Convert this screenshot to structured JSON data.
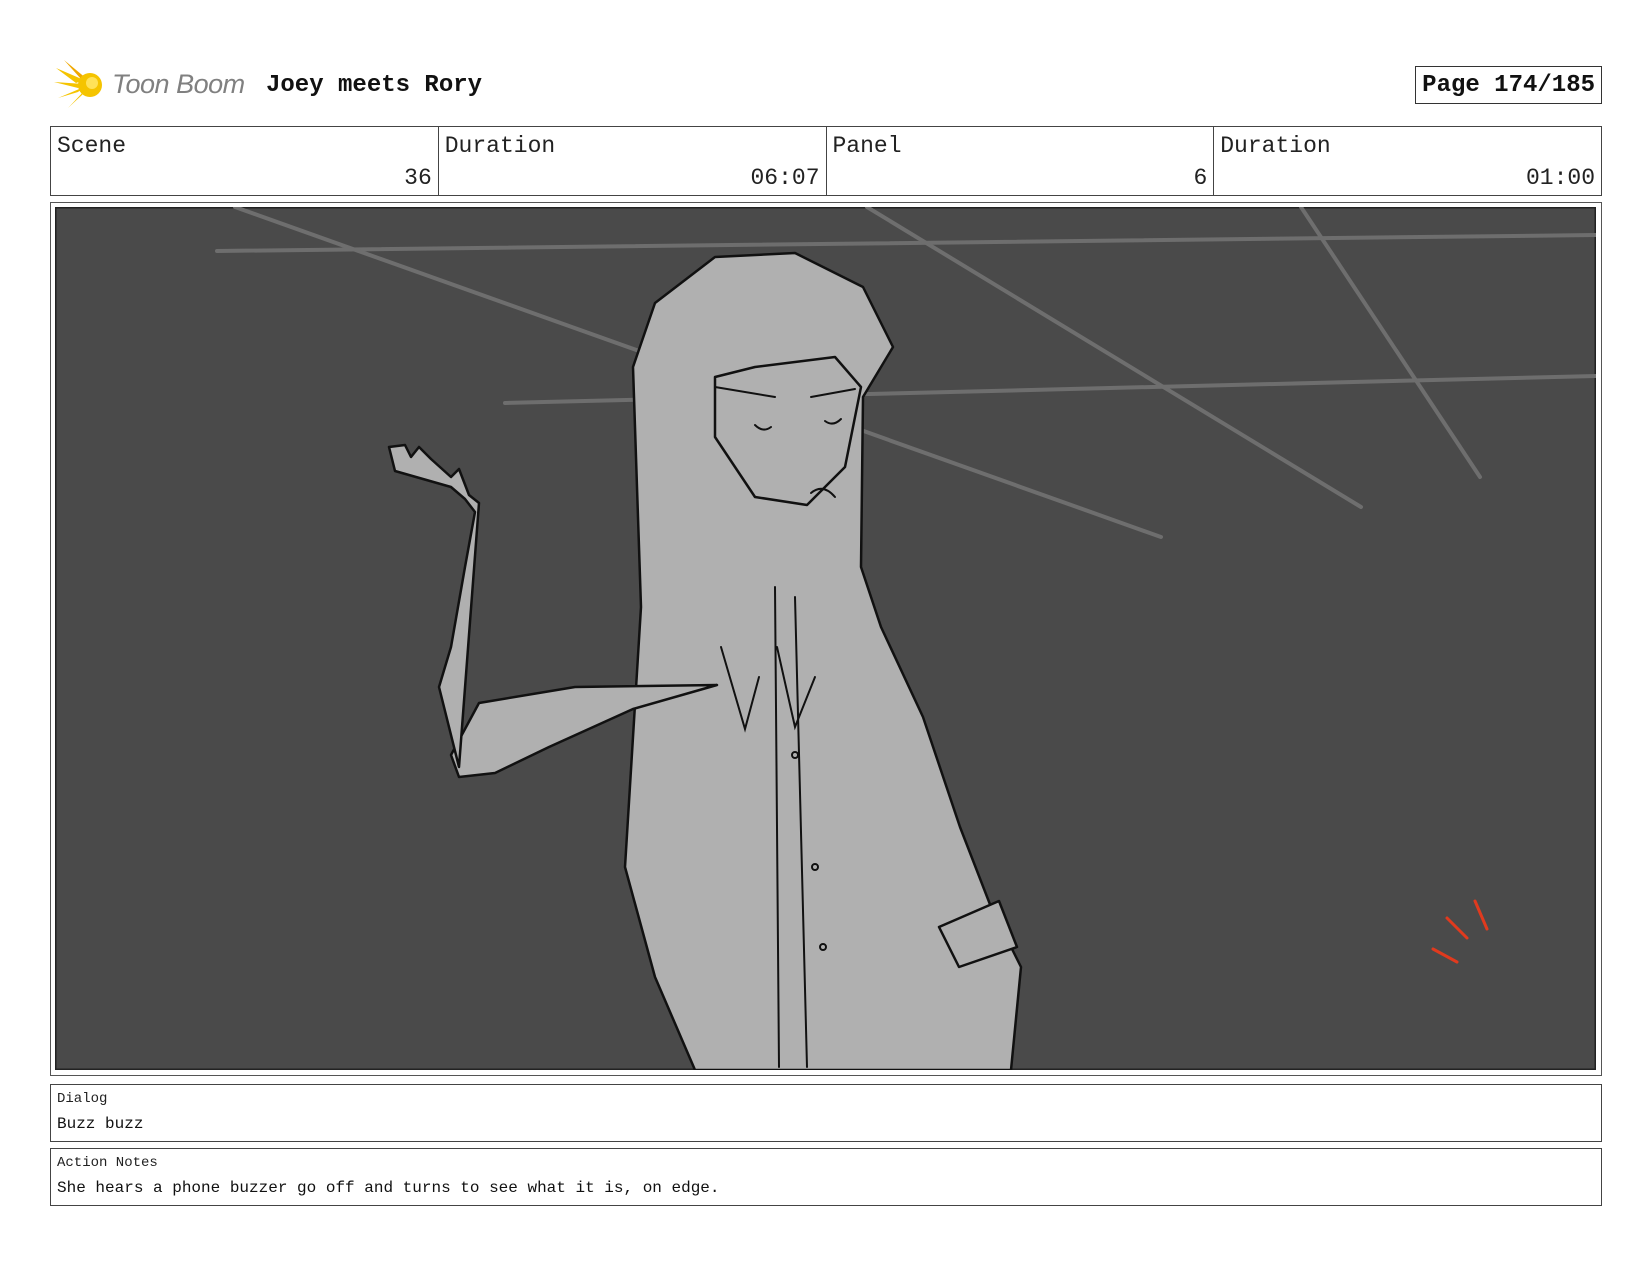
{
  "header": {
    "logo_text": "Toon Boom",
    "project_title": "Joey meets Rory",
    "page_label": "Page 174/185"
  },
  "info": {
    "scene_label": "Scene",
    "scene_value": "36",
    "scene_duration_label": "Duration",
    "scene_duration_value": "06:07",
    "panel_label": "Panel",
    "panel_value": "6",
    "panel_duration_label": "Duration",
    "panel_duration_value": "01:00"
  },
  "dialog": {
    "label": "Dialog",
    "text": "Buzz buzz"
  },
  "action_notes": {
    "label": "Action Notes",
    "text": "She hears a phone buzzer go off and turns to see what it is, on edge."
  },
  "colors": {
    "panel_background": "#4a4a4a",
    "figure_fill": "#b0b0b0",
    "buzz_marks": "#e03a1e",
    "logo_accent": "#f5c400"
  }
}
